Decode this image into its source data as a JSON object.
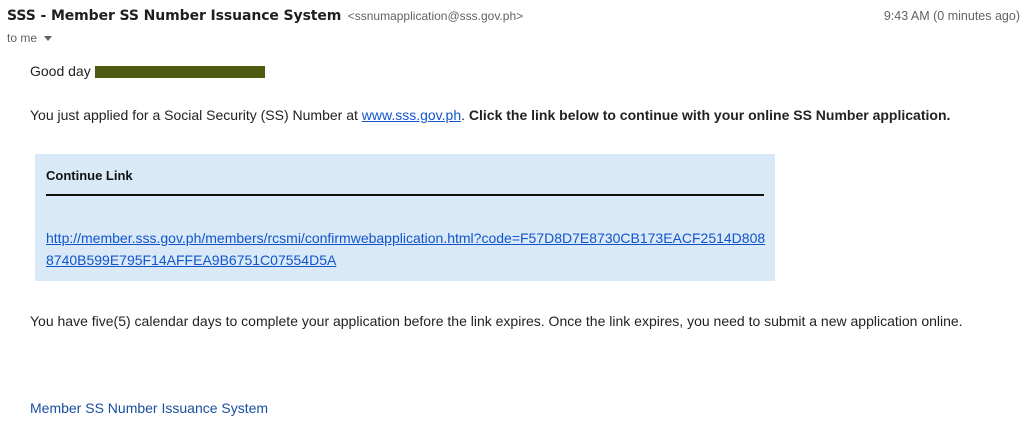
{
  "header": {
    "sender_name": "SSS - Member SS Number Issuance System",
    "sender_email": "<ssnumapplication@sss.gov.ph>",
    "timestamp": "9:43 AM (0 minutes ago)",
    "recipient": "to me",
    "recipient_caret_icon": "chevron-down-icon"
  },
  "body": {
    "greeting": "Good day",
    "intro_prefix": "You just applied for a Social Security (SS) Number at ",
    "intro_link": "www.sss.gov.ph",
    "intro_middle": ". ",
    "intro_bold": "Click the link below to continue with your online SS Number application.",
    "box": {
      "title": "Continue Link",
      "link": "http://member.sss.gov.ph/members/rcsmi/confirmwebapplication.html?code=F57D8D7E8730CB173EACF2514D8088740B599E795F14AFFEA9B6751C07554D5A"
    },
    "expiry_note": "You have five(5) calendar days to complete your application before the link expires. Once the link expires, you need to submit a new application online.",
    "signature": "Member SS Number Issuance System"
  },
  "colors": {
    "box_background": "#d9e9f7",
    "redaction": "#4d5a12",
    "link": "#1155cc"
  }
}
